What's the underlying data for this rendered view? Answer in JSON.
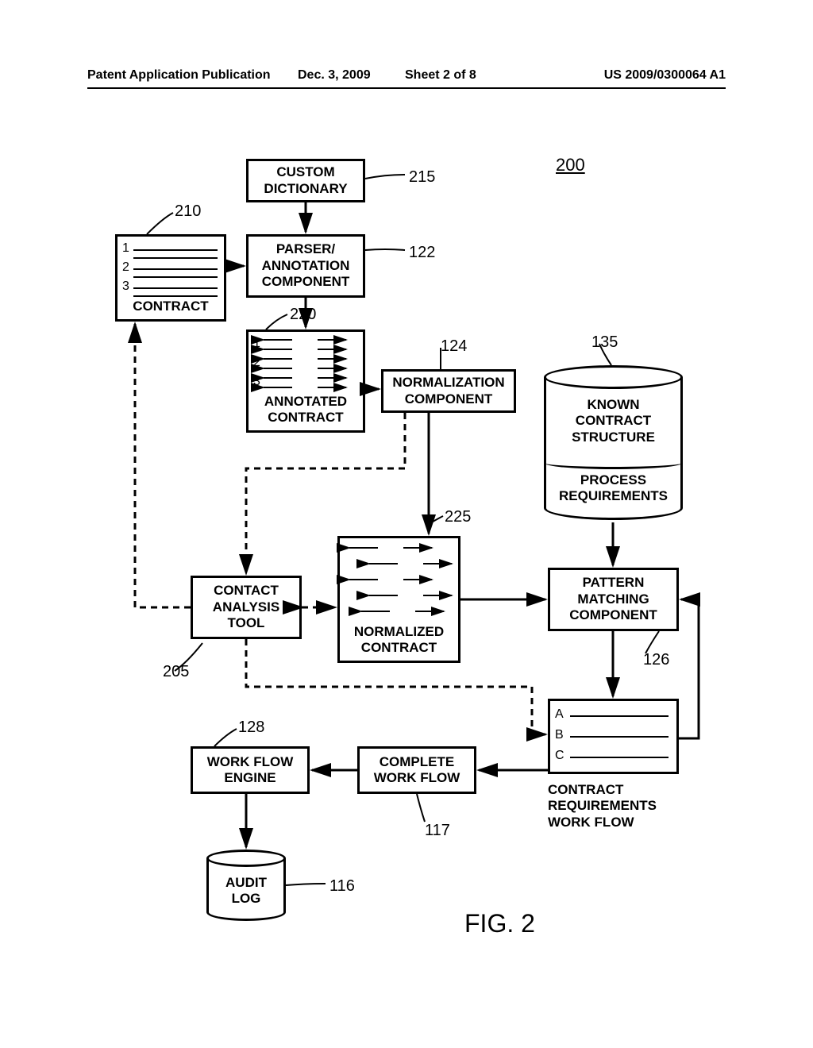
{
  "header": {
    "publication_type": "Patent Application Publication",
    "date": "Dec. 3, 2009",
    "sheet": "Sheet 2 of 8",
    "pub_number": "US 2009/0300064 A1"
  },
  "figure_label": "FIG. 2",
  "ref_num_200": "200",
  "boxes": {
    "custom_dictionary": "CUSTOM\nDICTIONARY",
    "parser_annotation": "PARSER/\nANNOTATION\nCOMPONENT",
    "normalization": "NORMALIZATION\nCOMPONENT",
    "contact_analysis": "CONTACT\nANALYSIS\nTOOL",
    "pattern_matching": "PATTERN\nMATCHING\nCOMPONENT",
    "workflow_engine": "WORK FLOW\nENGINE",
    "complete_workflow": "COMPLETE\nWORK FLOW"
  },
  "docs": {
    "contract": {
      "title": "CONTRACT",
      "rows": [
        "1",
        "2",
        "3"
      ]
    },
    "annotated_contract": {
      "title": "ANNOTATED\nCONTRACT",
      "rows": [
        "1",
        "2",
        "3"
      ]
    },
    "normalized_contract": {
      "title": "NORMALIZED\nCONTRACT"
    },
    "contract_req_workflow": {
      "title": "CONTRACT\nREQUIREMENTS\nWORK FLOW",
      "rows": [
        "A",
        "B",
        "C"
      ]
    }
  },
  "cylinders": {
    "known_structure": {
      "top_text": "KNOWN\nCONTRACT\nSTRUCTURE",
      "bottom_text": "PROCESS\nREQUIREMENTS"
    },
    "audit_log": "AUDIT\nLOG"
  },
  "refs": {
    "r210": "210",
    "r215": "215",
    "r122": "122",
    "r220": "220",
    "r124": "124",
    "r135": "135",
    "r205": "205",
    "r225": "225",
    "r126": "126",
    "r128": "128",
    "r117": "117",
    "r116": "116"
  }
}
